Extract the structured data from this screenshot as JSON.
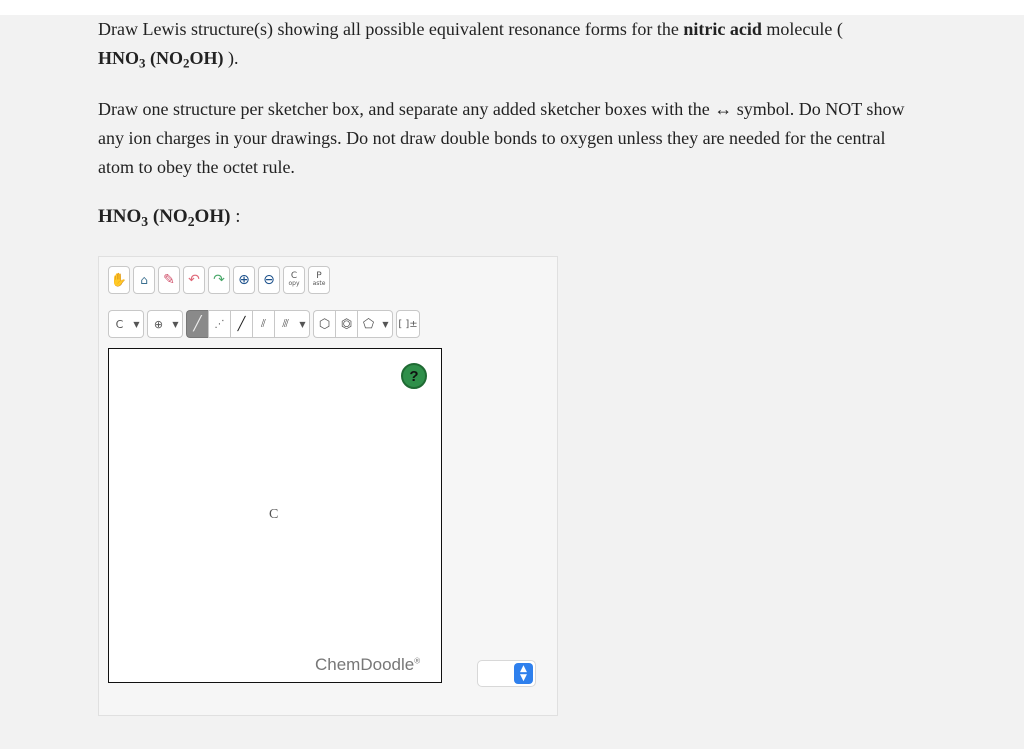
{
  "question": {
    "line1_pre": "Draw Lewis structure(s) showing all possible equivalent resonance forms for the ",
    "line1_bold": "nitric acid",
    "line1_post": " molecule (",
    "formula": {
      "a": "HNO",
      "a_sub": "3",
      "b": " (NO",
      "b_sub": "2",
      "c": "OH)"
    },
    "line2_post": " ).",
    "instructions": "Draw one structure per sketcher box, and separate any added sketcher boxes with the ↔ symbol. Do NOT show any ion charges in your drawings. Do not draw double bonds to oxygen unless they are needed for the central atom to obey the octet rule.",
    "label_colon": " :"
  },
  "toolbar": {
    "row1": [
      {
        "name": "hand-icon",
        "glyph": "✋"
      },
      {
        "name": "clear-icon",
        "glyph": "🧴"
      },
      {
        "name": "erase-icon",
        "glyph": "✏"
      },
      {
        "name": "undo-icon",
        "glyph": "↶"
      },
      {
        "name": "redo-icon",
        "glyph": "↷"
      },
      {
        "name": "zoom-in-icon",
        "glyph": "⊕"
      },
      {
        "name": "zoom-out-icon",
        "glyph": "⊖"
      },
      {
        "name": "copy-button",
        "glyph": "C opy"
      },
      {
        "name": "paste-button",
        "glyph": "P aste"
      }
    ],
    "atom_label": "C",
    "charge_glyph": "⊕",
    "bracket_glyph": "[ ]±"
  },
  "canvas": {
    "help": "?",
    "atom": "C",
    "brand": "ChemDoodle",
    "brand_mark": "®"
  }
}
